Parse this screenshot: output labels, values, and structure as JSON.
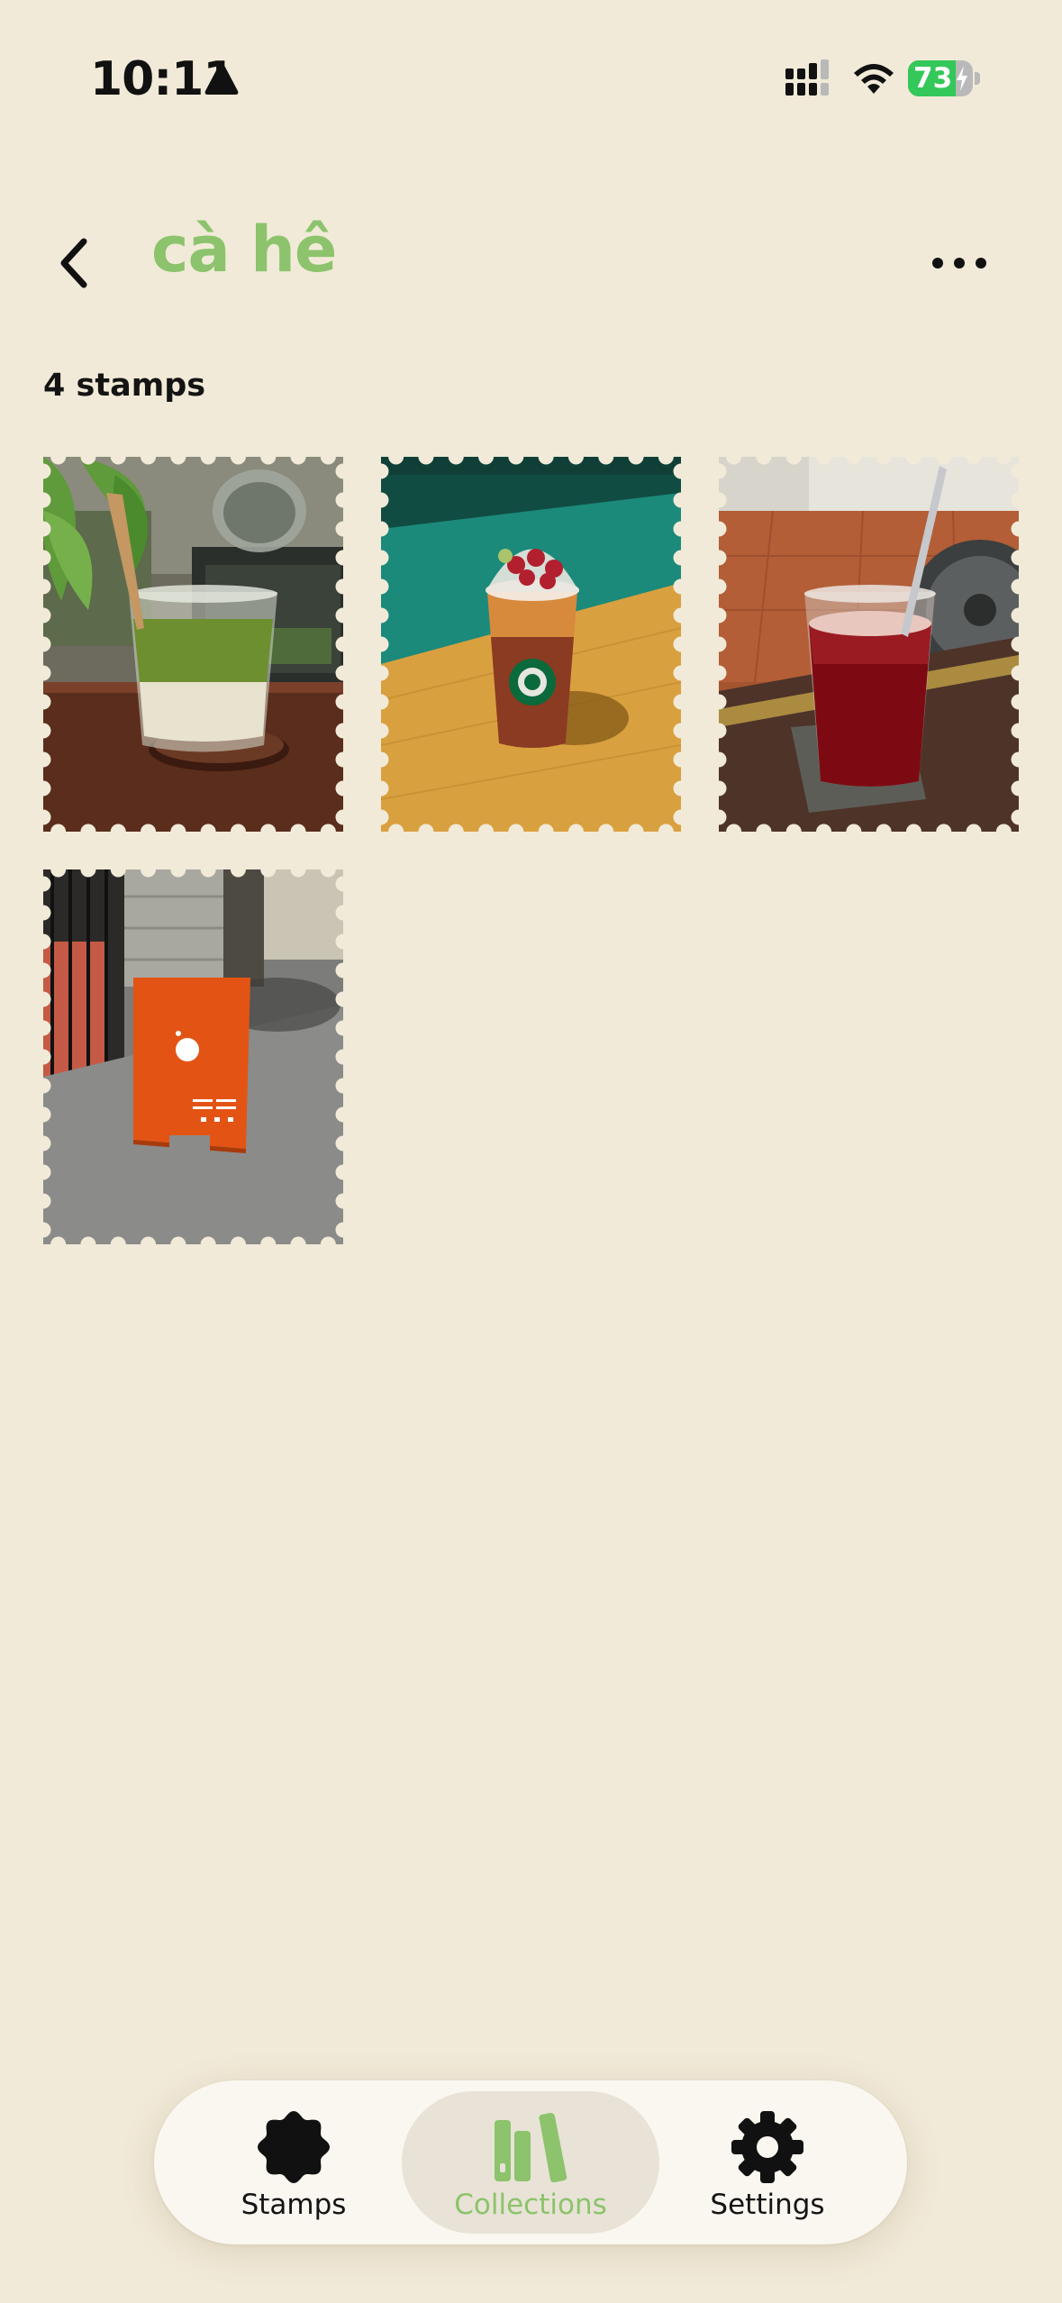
{
  "status_bar": {
    "time": "10:11",
    "battery_level": "73",
    "battery_fraction": 0.73,
    "battery_color": "#34C759",
    "charging": true
  },
  "header": {
    "title": "cà hê",
    "title_color": "#8CC36C",
    "back_icon": "chevron-left-icon",
    "more_icon": "ellipsis-icon"
  },
  "collection": {
    "count_label": "4 stamps",
    "stamps": [
      {
        "subject": "matcha latte glass on wooden table",
        "photo": "matcha"
      },
      {
        "subject": "starbucks iced drink with berries on table",
        "photo": "starbucks"
      },
      {
        "subject": "red iced tea with straw on coaster",
        "photo": "redtea"
      },
      {
        "subject": "orange cafe sign on sidewalk",
        "photo": "sign"
      }
    ]
  },
  "tab_bar": {
    "accent_color": "#8CC36C",
    "selected": "collections",
    "tabs": [
      {
        "id": "stamps",
        "label": "Stamps",
        "icon": "stamp-badge-icon"
      },
      {
        "id": "collections",
        "label": "Collections",
        "icon": "books-icon"
      },
      {
        "id": "settings",
        "label": "Settings",
        "icon": "gear-icon"
      }
    ]
  }
}
